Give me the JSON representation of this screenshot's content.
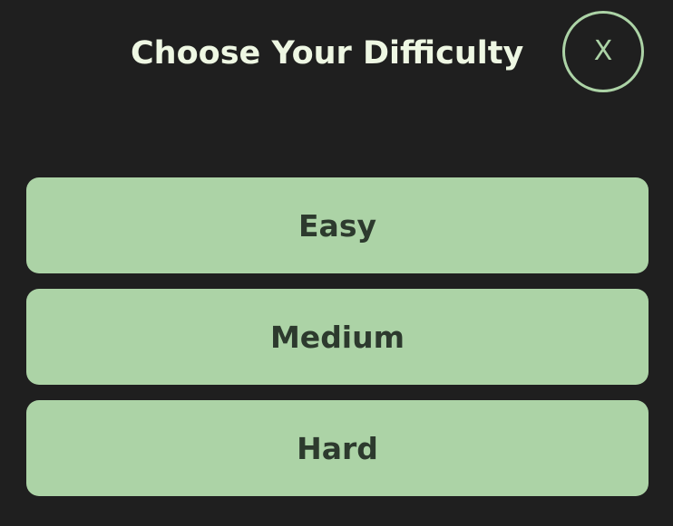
{
  "dialog": {
    "title": "Choose Your Difficulty",
    "close_label": "X"
  },
  "options": [
    {
      "label": "Easy"
    },
    {
      "label": "Medium"
    },
    {
      "label": "Hard"
    }
  ],
  "colors": {
    "background": "#1f1f1f",
    "title_text": "#eef7e3",
    "accent_green": "#acd3a6",
    "button_text": "#2d3a2e"
  }
}
